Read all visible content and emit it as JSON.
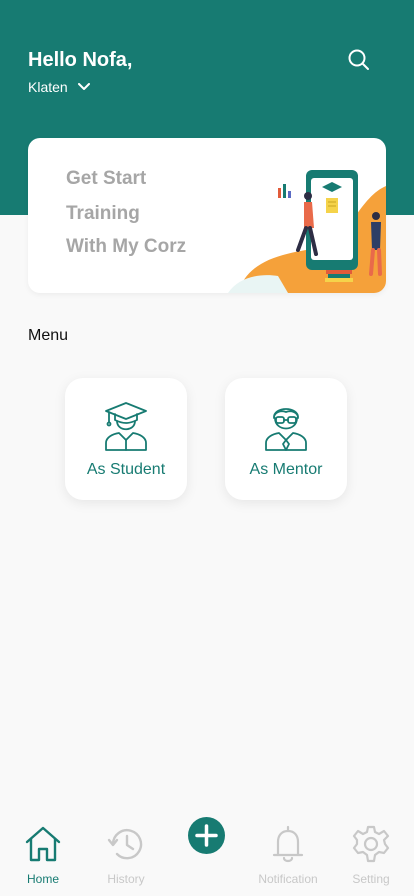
{
  "header": {
    "greeting": "Hello Nofa,",
    "location": "Klaten",
    "icons": {
      "search": "search-icon",
      "location_toggle": "chevron-down-icon"
    }
  },
  "banner": {
    "lines": [
      "Get Start",
      "Training",
      "With My Corz"
    ]
  },
  "menu": {
    "title": "Menu",
    "items": [
      {
        "label": "As Student",
        "icon": "student-icon"
      },
      {
        "label": "As Mentor",
        "icon": "mentor-icon"
      }
    ]
  },
  "bottom_nav": {
    "items": [
      {
        "label": "Home",
        "icon": "home-icon",
        "active": true
      },
      {
        "label": "History",
        "icon": "history-icon",
        "active": false
      },
      {
        "label": "Notification",
        "icon": "bell-icon",
        "active": false
      },
      {
        "label": "Setting",
        "icon": "gear-icon",
        "active": false
      }
    ],
    "fab_icon": "plus-icon"
  },
  "colors": {
    "primary": "#177b72",
    "accent": "#f5a13a",
    "background": "#f9f9f9",
    "inactive": "#c8c8c8",
    "banner_text": "#a6a6a6"
  }
}
